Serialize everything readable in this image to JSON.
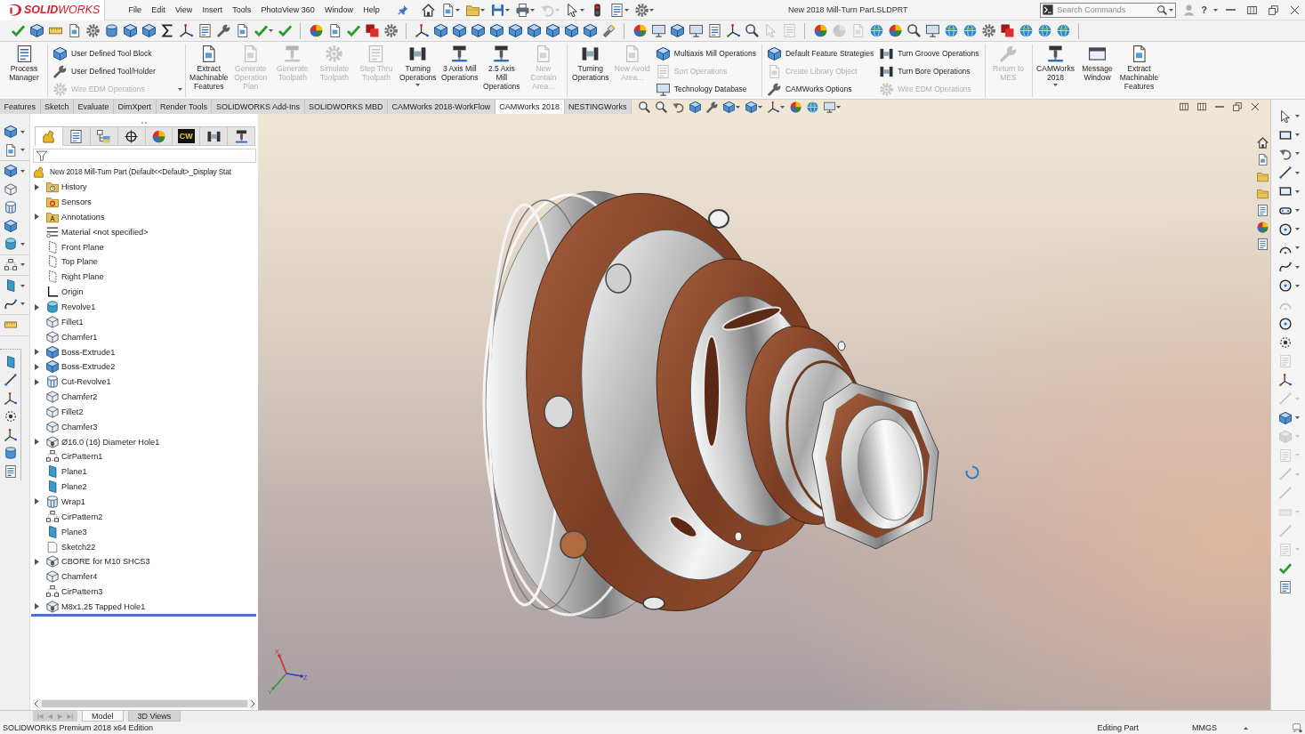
{
  "title_bar": {
    "logo": "**SOLID**WORKS",
    "menu": [
      "File",
      "Edit",
      "View",
      "Insert",
      "Tools",
      "PhotoView 360",
      "Window",
      "Help"
    ],
    "quick_access": [
      {
        "kind": "home",
        "disabled": false
      },
      {
        "kind": "page",
        "dropdown": true,
        "disabled": false
      },
      {
        "kind": "folder",
        "dropdown": true,
        "disabled": false
      },
      {
        "kind": "disk",
        "dropdown": true,
        "disabled": false
      },
      {
        "kind": "printer",
        "dropdown": true,
        "disabled": false
      },
      {
        "kind": "undo",
        "dropdown": true,
        "disabled": true
      },
      {
        "kind": "pointer",
        "dropdown": true,
        "disabled": false
      },
      {
        "kind": "signal",
        "disabled": false
      },
      {
        "kind": "sheet",
        "dropdown": true,
        "disabled": false
      },
      {
        "kind": "gear",
        "dropdown": true,
        "disabled": false
      }
    ],
    "document_title": "New 2018 Mill-Turn Part.SLDPRT",
    "search": {
      "placeholder": "Search Commands"
    },
    "help": "?"
  },
  "toolbar": [
    [
      {
        "kind": "check",
        "disabled": false
      },
      {
        "kind": "cube",
        "disabled": false
      },
      {
        "kind": "ruler",
        "disabled": false
      },
      {
        "kind": "page",
        "disabled": false
      },
      {
        "kind": "gear",
        "disabled": false
      },
      {
        "kind": "cylinder",
        "disabled": false
      },
      {
        "kind": "cube",
        "disabled": false
      },
      {
        "kind": "cube",
        "disabled": false
      },
      {
        "kind": "sigma",
        "disabled": false
      },
      {
        "kind": "triad",
        "disabled": false
      },
      {
        "kind": "sheet",
        "disabled": false
      },
      {
        "kind": "wrench",
        "disabled": false
      },
      {
        "kind": "page",
        "disabled": false
      },
      {
        "kind": "check",
        "dropdown": true,
        "disabled": false
      },
      {
        "kind": "check",
        "disabled": false
      }
    ],
    [
      {
        "kind": "ball",
        "disabled": false
      },
      {
        "kind": "page",
        "disabled": false
      },
      {
        "kind": "check",
        "disabled": false
      },
      {
        "kind": "square",
        "disabled": false
      },
      {
        "kind": "gear",
        "disabled": false
      }
    ],
    [
      {
        "kind": "triad",
        "disabled": false
      },
      {
        "kind": "cube",
        "disabled": false
      },
      {
        "kind": "cube",
        "disabled": false
      },
      {
        "kind": "cube",
        "disabled": false
      },
      {
        "kind": "cube",
        "disabled": false
      },
      {
        "kind": "cube",
        "disabled": false
      },
      {
        "kind": "cube",
        "disabled": false
      },
      {
        "kind": "cube",
        "disabled": false
      },
      {
        "kind": "cube",
        "disabled": false
      },
      {
        "kind": "cube",
        "disabled": false
      },
      {
        "kind": "flashlight",
        "disabled": false
      }
    ],
    [
      {
        "kind": "ball",
        "disabled": false
      },
      {
        "kind": "monitor",
        "disabled": false
      },
      {
        "kind": "cube",
        "disabled": false
      },
      {
        "kind": "monitor",
        "disabled": false
      },
      {
        "kind": "sheet",
        "disabled": false
      },
      {
        "kind": "triad",
        "disabled": false
      },
      {
        "kind": "magnifier",
        "disabled": false
      },
      {
        "kind": "pointer",
        "disabled": true
      },
      {
        "kind": "sheet",
        "disabled": true
      }
    ],
    [
      {
        "kind": "ball",
        "disabled": false
      },
      {
        "kind": "ball",
        "disabled": true
      },
      {
        "kind": "page",
        "disabled": true
      },
      {
        "kind": "globe",
        "disabled": false
      },
      {
        "kind": "ball",
        "disabled": false
      },
      {
        "kind": "magnifier",
        "disabled": false
      },
      {
        "kind": "monitor",
        "disabled": false
      },
      {
        "kind": "globe",
        "disabled": false
      },
      {
        "kind": "globe",
        "disabled": false
      },
      {
        "kind": "gear",
        "disabled": false
      },
      {
        "kind": "square",
        "disabled": false
      },
      {
        "kind": "globe",
        "disabled": false
      },
      {
        "kind": "globe",
        "disabled": false
      },
      {
        "kind": "globe",
        "disabled": false
      }
    ]
  ],
  "command_manager": {
    "groups": [
      [
        {
          "kind": "sheet",
          "label": "Process Manager",
          "disabled": false
        }
      ],
      [
        {
          "rows": [
            {
              "kind": "cube",
              "label": "User Defined Tool Block",
              "disabled": false
            },
            {
              "kind": "wrench",
              "label": "User Defined Tool/Holder",
              "disabled": false
            },
            {
              "kind": "gear",
              "label": "Wire EDM Operations",
              "disabled": true
            }
          ],
          "dropdown": true
        }
      ],
      [
        {
          "kind": "page",
          "label": "Extract Machinable Features",
          "disabled": false
        },
        {
          "kind": "page",
          "label": "Generate Operation Plan",
          "disabled": true
        },
        {
          "kind": "mill",
          "label": "Generate Toolpath",
          "disabled": true
        },
        {
          "kind": "gear",
          "label": "Simulate Toolpath",
          "disabled": true
        },
        {
          "kind": "sheet",
          "label": "Step Thru Toolpath",
          "disabled": true
        },
        {
          "kind": "lathe",
          "label": "Turning Operations",
          "dropdown": true,
          "disabled": false
        },
        {
          "kind": "mill",
          "label": "3 Axis Mill Operations",
          "disabled": false
        },
        {
          "kind": "mill",
          "label": "2.5 Axis Mill Operations",
          "disabled": false
        },
        {
          "kind": "page",
          "label": "New Contain Area...",
          "disabled": true
        }
      ],
      [
        {
          "kind": "lathe",
          "label": "Turning Operations",
          "disabled": false
        },
        {
          "kind": "page",
          "label": "New Avoid Area...",
          "disabled": true
        },
        {
          "rows": [
            {
              "kind": "cube",
              "label": "Multiaxis Mill Operations",
              "disabled": false
            },
            {
              "kind": "sheet",
              "label": "Sort Operations",
              "disabled": true
            },
            {
              "kind": "monitor",
              "label": "Technology Database",
              "disabled": false
            }
          ]
        }
      ],
      [
        {
          "rows": [
            {
              "kind": "cube",
              "label": "Default Feature Strategies",
              "disabled": false
            },
            {
              "kind": "page",
              "label": "Create Library Object",
              "disabled": true
            },
            {
              "kind": "wrench",
              "label": "CAMWorks Options",
              "disabled": false
            }
          ]
        },
        {
          "rows": [
            {
              "kind": "lathe",
              "label": "Turn Groove Operations",
              "disabled": false
            },
            {
              "kind": "lathe",
              "label": "Turn Bore Operations",
              "disabled": false
            },
            {
              "kind": "gear",
              "label": "Wire EDM Operations",
              "disabled": true
            }
          ]
        }
      ],
      [
        {
          "kind": "wrench",
          "label": "Return to MES",
          "disabled": true
        }
      ],
      [
        {
          "kind": "mill",
          "label": "CAMWorks 2018",
          "dropdown": true,
          "disabled": false
        },
        {
          "kind": "window",
          "label": "Message Window",
          "disabled": false
        },
        {
          "kind": "page",
          "label": "Extract Machinable Features",
          "disabled": false
        }
      ]
    ]
  },
  "tabs": [
    {
      "label": "Features",
      "selected": false
    },
    {
      "label": "Sketch",
      "selected": false
    },
    {
      "label": "Evaluate",
      "selected": false
    },
    {
      "label": "DimXpert",
      "selected": false
    },
    {
      "label": "Render Tools",
      "selected": false
    },
    {
      "label": "SOLIDWORKS Add-Ins",
      "selected": false
    },
    {
      "label": "SOLIDWORKS MBD",
      "selected": false
    },
    {
      "label": "CAMWorks 2018-WorkFlow",
      "selected": false
    },
    {
      "label": "CAMWorks 2018",
      "selected": true
    },
    {
      "label": "NESTINGWorks",
      "selected": false
    }
  ],
  "feature_manager_tabs": [
    {
      "kind": "part",
      "selected": true
    },
    {
      "kind": "sheet",
      "selected": false
    },
    {
      "kind": "config",
      "selected": false
    },
    {
      "kind": "target",
      "selected": false
    },
    {
      "kind": "ball",
      "selected": false
    },
    {
      "label": "CW",
      "selected": false
    },
    {
      "kind": "lathe",
      "selected": false
    },
    {
      "kind": "mill",
      "selected": false
    }
  ],
  "feature_tree": {
    "root": {
      "kind": "part",
      "label": "New 2018 Mill-Turn Part (Default<<Default>_Display Stat",
      "children": [
        {
          "kind": "history",
          "label": "History",
          "expandable": true
        },
        {
          "kind": "sensor",
          "label": "Sensors",
          "expandable": false
        },
        {
          "kind": "annotations",
          "label": "Annotations",
          "expandable": true
        },
        {
          "kind": "material",
          "label": "Material <not specified>",
          "expandable": false
        },
        {
          "kind": "plane",
          "label": "Front Plane",
          "expandable": false
        },
        {
          "kind": "plane",
          "label": "Top Plane",
          "expandable": false
        },
        {
          "kind": "plane",
          "label": "Right Plane",
          "expandable": false
        },
        {
          "kind": "origin",
          "label": "Origin",
          "expandable": false
        },
        {
          "kind": "revolve",
          "label": "Revolve1",
          "expandable": true
        },
        {
          "kind": "fillet",
          "label": "Fillet1",
          "expandable": false
        },
        {
          "kind": "fillet",
          "label": "Chamfer1",
          "expandable": false
        },
        {
          "kind": "extrude",
          "label": "Boss-Extrude1",
          "expandable": true
        },
        {
          "kind": "extrude",
          "label": "Boss-Extrude2",
          "expandable": true
        },
        {
          "kind": "cut",
          "label": "Cut-Revolve1",
          "expandable": true
        },
        {
          "kind": "fillet",
          "label": "Chamfer2",
          "expandable": false
        },
        {
          "kind": "fillet",
          "label": "Fillet2",
          "expandable": false
        },
        {
          "kind": "fillet",
          "label": "Chamfer3",
          "expandable": false
        },
        {
          "kind": "hole",
          "label": "Ø16.0 (16) Diameter Hole1",
          "expandable": true
        },
        {
          "kind": "pattern",
          "label": "CirPattern1",
          "expandable": false
        },
        {
          "kind": "refplane",
          "label": "Plane1",
          "expandable": false
        },
        {
          "kind": "refplane",
          "label": "Plane2",
          "expandable": false
        },
        {
          "kind": "cut",
          "label": "Wrap1",
          "expandable": true
        },
        {
          "kind": "pattern",
          "label": "CirPattern2",
          "expandable": false
        },
        {
          "kind": "refplane",
          "label": "Plane3",
          "expandable": false
        },
        {
          "kind": "sketch",
          "label": "Sketch22",
          "expandable": false
        },
        {
          "kind": "hole",
          "label": "CBORE for M10 SHCS3",
          "expandable": true
        },
        {
          "kind": "fillet",
          "label": "Chamfer4",
          "expandable": false
        },
        {
          "kind": "pattern",
          "label": "CirPattern3",
          "expandable": false
        },
        {
          "kind": "hole",
          "label": "M8x1.25 Tapped Hole1",
          "expandable": true
        }
      ]
    }
  },
  "triad": {
    "axes": [
      {
        "label": "X"
      },
      {
        "label": "Y"
      },
      {
        "label": "Z"
      }
    ]
  },
  "sketch_toolbar": [
    {
      "kind": "pointer",
      "dropdown": true,
      "disabled": false
    },
    {
      "kind": "rect",
      "dropdown": true,
      "disabled": false
    },
    {
      "kind": "undo",
      "dropdown": true,
      "disabled": false
    },
    {
      "kind": "line",
      "dropdown": true,
      "disabled": false
    },
    {
      "kind": "rect",
      "dropdown": true,
      "disabled": false
    },
    {
      "kind": "slot",
      "dropdown": true,
      "disabled": false
    },
    {
      "kind": "circle",
      "dropdown": true,
      "disabled": false
    },
    {
      "kind": "arc",
      "dropdown": true,
      "disabled": false
    },
    {
      "kind": "spline",
      "dropdown": true,
      "disabled": false
    },
    {
      "kind": "circle",
      "dropdown": true,
      "disabled": false
    },
    {
      "kind": "arc",
      "disabled": true
    },
    {
      "kind": "circle",
      "disabled": false
    },
    {
      "kind": "point",
      "disabled": false
    },
    {
      "kind": "sheet",
      "disabled": true
    },
    {
      "kind": "triad",
      "disabled": false
    },
    {
      "kind": "line",
      "dropdown": true,
      "disabled": true
    },
    {
      "kind": "cube",
      "dropdown": true,
      "disabled": false
    },
    {
      "kind": "cube",
      "dropdown": true,
      "disabled": true
    },
    {
      "kind": "sheet",
      "dropdown": true,
      "disabled": true
    },
    {
      "kind": "line",
      "dropdown": true,
      "disabled": true
    },
    {
      "kind": "line",
      "disabled": true
    },
    {
      "kind": "ruler",
      "dropdown": true,
      "disabled": true
    },
    {
      "kind": "line",
      "disabled": true
    },
    {
      "kind": "sheet",
      "dropdown": true,
      "disabled": true
    },
    {
      "kind": "check",
      "disabled": false
    },
    {
      "kind": "sheet",
      "disabled": false
    }
  ],
  "bottom_tabs": [
    {
      "label": "Model",
      "selected": true
    },
    {
      "label": "3D Views",
      "selected": false
    }
  ],
  "status_bar": {
    "edition": "SOLIDWORKS Premium 2018 x64 Edition",
    "mode": "Editing Part",
    "units": "MMGS"
  }
}
